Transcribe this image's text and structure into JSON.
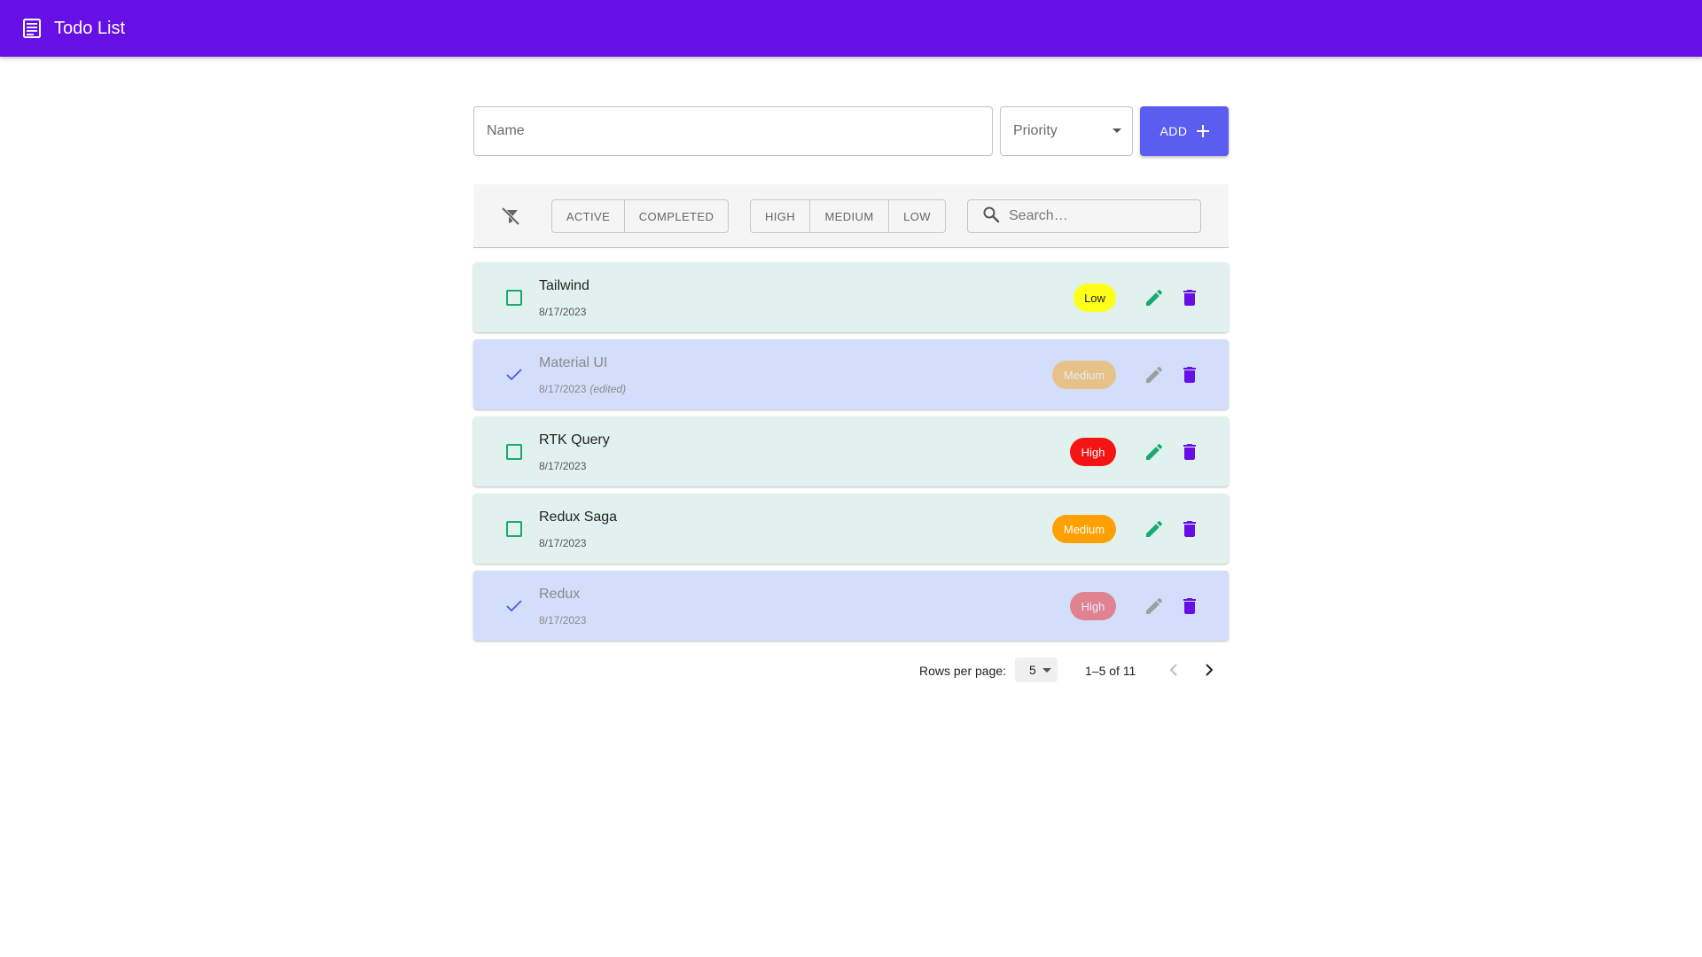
{
  "header": {
    "title": "Todo List",
    "bg_color": "#6610e6",
    "icon": "checklist-icon"
  },
  "add_form": {
    "name_placeholder": "Name",
    "priority_placeholder": "Priority",
    "add_label": "ADD",
    "add_color": "#5b5cf0"
  },
  "filters": {
    "clear_icon": "filter-off-icon",
    "status": [
      {
        "label": "ACTIVE"
      },
      {
        "label": "COMPLETED"
      }
    ],
    "priority": [
      {
        "label": "HIGH"
      },
      {
        "label": "MEDIUM"
      },
      {
        "label": "LOW"
      }
    ],
    "search_placeholder": "Search…"
  },
  "todos": [
    {
      "name": "Tailwind",
      "date": "8/17/2023",
      "edited_label": "",
      "priority": "Low",
      "completed": false
    },
    {
      "name": "Material UI",
      "date": "8/17/2023",
      "edited_label": "(edited)",
      "priority": "Medium",
      "completed": true
    },
    {
      "name": "RTK Query",
      "date": "8/17/2023",
      "edited_label": "",
      "priority": "High",
      "completed": false
    },
    {
      "name": "Redux Saga",
      "date": "8/17/2023",
      "edited_label": "",
      "priority": "Medium",
      "completed": false
    },
    {
      "name": "Redux",
      "date": "8/17/2023",
      "edited_label": "",
      "priority": "High",
      "completed": true
    }
  ],
  "colors": {
    "active_row": "#e1f2ee",
    "completed_row": "#d2defa",
    "low": "#ffff1a",
    "medium": "#ffa000",
    "high": "#f51414",
    "edit_icon_active": "#19a971",
    "delete_icon": "#6610e6"
  },
  "pagination": {
    "rows_per_page_label": "Rows per page:",
    "rows_per_page": "5",
    "range": "1–5 of 11"
  }
}
